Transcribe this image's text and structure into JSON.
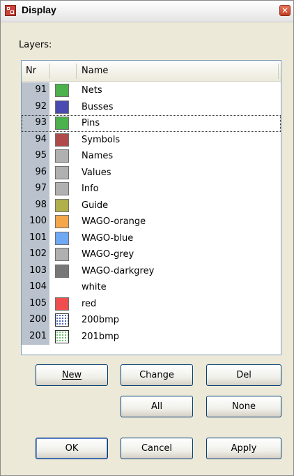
{
  "window": {
    "title": "Display",
    "close_glyph": "✕"
  },
  "layers_label": "Layers:",
  "columns": {
    "nr": "Nr",
    "name": "Name"
  },
  "focused_row_index": 2,
  "rows": [
    {
      "nr": "91",
      "name": "Nets",
      "color": "#4cb04c",
      "pattern": "solid"
    },
    {
      "nr": "92",
      "name": "Busses",
      "color": "#4a4ab0",
      "pattern": "solid"
    },
    {
      "nr": "93",
      "name": "Pins",
      "color": "#4cb04c",
      "pattern": "solid"
    },
    {
      "nr": "94",
      "name": "Symbols",
      "color": "#b04a4a",
      "pattern": "solid"
    },
    {
      "nr": "95",
      "name": "Names",
      "color": "#b0b0b0",
      "pattern": "solid"
    },
    {
      "nr": "96",
      "name": "Values",
      "color": "#b0b0b0",
      "pattern": "solid"
    },
    {
      "nr": "97",
      "name": "Info",
      "color": "#b0b0b0",
      "pattern": "solid"
    },
    {
      "nr": "98",
      "name": "Guide",
      "color": "#b0b04a",
      "pattern": "solid"
    },
    {
      "nr": "100",
      "name": "WAGO-orange",
      "color": "#f5a64a",
      "pattern": "solid"
    },
    {
      "nr": "101",
      "name": "WAGO-blue",
      "color": "#6fa8f5",
      "pattern": "solid"
    },
    {
      "nr": "102",
      "name": "WAGO-grey",
      "color": "#b0b0b0",
      "pattern": "solid"
    },
    {
      "nr": "103",
      "name": "WAGO-darkgrey",
      "color": "#777777",
      "pattern": "solid"
    },
    {
      "nr": "104",
      "name": "white",
      "color": "#ffffff",
      "pattern": "none"
    },
    {
      "nr": "105",
      "name": "red",
      "color": "#f04e4e",
      "pattern": "solid"
    },
    {
      "nr": "200",
      "name": "200bmp",
      "color": "#1c3fa8",
      "pattern": "dots"
    },
    {
      "nr": "201",
      "name": "201bmp",
      "color": "#4cb04c",
      "pattern": "dots"
    }
  ],
  "buttons": {
    "new": "New",
    "change": "Change",
    "del": "Del",
    "all": "All",
    "none": "None",
    "ok": "OK",
    "cancel": "Cancel",
    "apply": "Apply"
  }
}
